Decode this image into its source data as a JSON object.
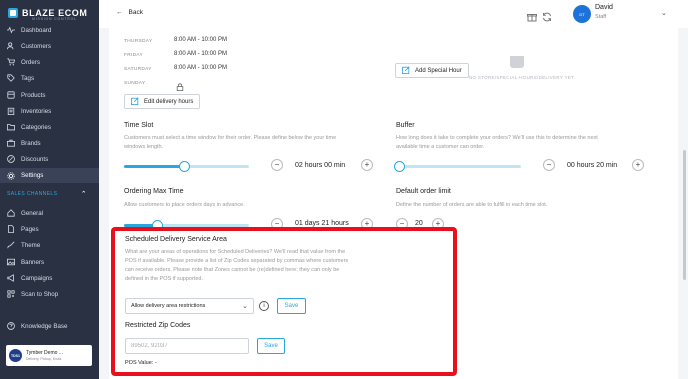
{
  "brand": {
    "name": "BLAZE ECOM",
    "tagline": "MISSION CONTROL"
  },
  "sidebar": {
    "items": [
      {
        "label": "Dashboard",
        "icon": "pulse-icon"
      },
      {
        "label": "Customers",
        "icon": "users-icon"
      },
      {
        "label": "Orders",
        "icon": "cart-icon"
      },
      {
        "label": "Tags",
        "icon": "tag-icon"
      },
      {
        "label": "Products",
        "icon": "box-icon"
      },
      {
        "label": "Inventories",
        "icon": "clipboard-icon"
      },
      {
        "label": "Categories",
        "icon": "folder-icon"
      },
      {
        "label": "Brands",
        "icon": "briefcase-icon"
      },
      {
        "label": "Discounts",
        "icon": "percent-icon"
      },
      {
        "label": "Settings",
        "icon": "gear-icon",
        "active": true
      }
    ],
    "section_title": "SALES CHANNELS",
    "channel_items": [
      {
        "label": "General",
        "icon": "home-icon"
      },
      {
        "label": "Pages",
        "icon": "file-icon"
      },
      {
        "label": "Theme",
        "icon": "brush-icon"
      },
      {
        "label": "Banners",
        "icon": "image-icon"
      },
      {
        "label": "Campaigns",
        "icon": "megaphone-icon"
      },
      {
        "label": "Scan to Shop",
        "icon": "qr-icon"
      }
    ],
    "knowledge_base": "Knowledge Base",
    "store": {
      "initials": "TDS1",
      "name": "Tymber Demo ...",
      "sub": "Delivery, Pickup, Kiosk"
    }
  },
  "header": {
    "back_label": "Back",
    "user": {
      "initials": "DT",
      "name": "David",
      "role": "Staff"
    }
  },
  "schedule": {
    "days": [
      {
        "day": "THURSDAY",
        "hours": "8:00 AM - 10:00 PM"
      },
      {
        "day": "FRIDAY",
        "hours": "8:00 AM - 10:00 PM"
      },
      {
        "day": "SATURDAY",
        "hours": "8:00 AM - 10:00 PM"
      },
      {
        "day": "SUNDAY",
        "hours": ""
      }
    ],
    "edit_button": "Edit delivery hours",
    "no_special_hours": "NO STORE/SPECIAL-HOURS/DELIVERY YET.",
    "add_special_button": "Add Special Hour"
  },
  "time_slot": {
    "title": "Time Slot",
    "description_lines": [
      "Customers must select a time window for their order. Please define below the your time",
      "windows length."
    ],
    "value": "02 hours 00 min",
    "slider_percent": 48
  },
  "buffer": {
    "title": "Buffer",
    "description_lines": [
      "How long does it take to complete your orders? We'll use this to determine the next",
      "available time a customer can order."
    ],
    "value": "00 hours 20 min",
    "slider_percent": 2
  },
  "ordering_max_time": {
    "title": "Ordering Max Time",
    "description": "Allow customers to place orders days in advance.",
    "value": "01 days 21 hours",
    "slider_percent": 26
  },
  "default_order_limit": {
    "title": "Default order limit",
    "description": "Define the number of orders are able to fulfill in each time slot.",
    "value": "20"
  },
  "scheduled_delivery": {
    "title": "Scheduled Delivery Service Area",
    "description_lines": [
      "What are your areas of operations for Scheduled Deliveries? We'll read that value from the",
      "POS if available. Please provide a list of Zip Codes separated by commas where customers",
      "can receive orders. Please note that Zones cannot be (re)defined here; they can only be",
      "defined in the POS if supported."
    ],
    "select_value": "Allow delivery area restrictions",
    "save_label": "Save",
    "restricted_title": "Restricted Zip Codes",
    "zip_placeholder": "89502, 92037",
    "zip_save_label": "Save",
    "pos_value": "POS Value: -"
  },
  "colors": {
    "accent": "#2aa7df",
    "sidebar": "#2a3142",
    "highlight": "#e8101a"
  }
}
